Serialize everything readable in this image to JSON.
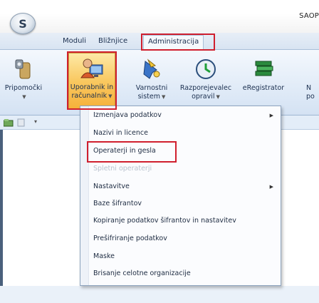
{
  "window": {
    "title": "SAOP"
  },
  "app_button": {
    "letter": "S"
  },
  "tabs": [
    {
      "label": "Moduli",
      "active": false
    },
    {
      "label": "Bližnjice",
      "active": false
    },
    {
      "label": "Administracija",
      "active": true
    }
  ],
  "ribbon": {
    "buttons": [
      {
        "line1": "Pripomočki",
        "line2": "",
        "icon": "tools-icon"
      },
      {
        "line1": "Uporabnik in",
        "line2": "računalnik",
        "icon": "user-computer-icon",
        "selected": true
      },
      {
        "line1": "Varnostni",
        "line2": "sistem",
        "icon": "security-key-icon"
      },
      {
        "line1": "Razporejevalec",
        "line2": "opravil",
        "icon": "scheduler-clock-icon"
      },
      {
        "line1": "eRegistrator",
        "line2": "",
        "icon": "books-icon"
      },
      {
        "line1": "N",
        "line2": "po",
        "icon": "partial-icon"
      }
    ]
  },
  "menu": {
    "items": [
      {
        "label": "Izmenjava podatkov",
        "submenu": true,
        "disabled": false
      },
      {
        "label": "Nazivi in licence",
        "submenu": false,
        "disabled": false
      },
      {
        "label": "Operaterji in gesla",
        "submenu": false,
        "disabled": false,
        "highlighted": true
      },
      {
        "label": "Spletni operaterji",
        "submenu": false,
        "disabled": true
      },
      {
        "label": "Nastavitve",
        "submenu": true,
        "disabled": false
      },
      {
        "label": "Baze šifrantov",
        "submenu": false,
        "disabled": false
      },
      {
        "label": "Kopiranje podatkov šifrantov in nastavitev",
        "submenu": false,
        "disabled": false
      },
      {
        "label": "Prešifriranje podatkov",
        "submenu": false,
        "disabled": false
      },
      {
        "label": "Maske",
        "submenu": false,
        "disabled": false
      },
      {
        "label": "Brisanje celotne organizacije",
        "submenu": false,
        "disabled": false
      }
    ]
  },
  "colors": {
    "highlight_box": "#d01f2e",
    "ribbon_selected": "#f9c860"
  }
}
